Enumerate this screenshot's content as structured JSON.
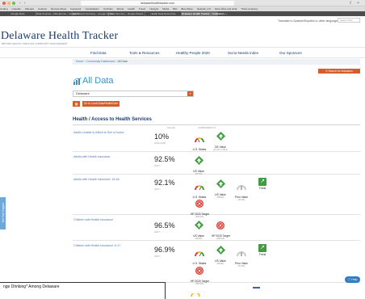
{
  "browser": {
    "url": "delawarehealthtracker.com",
    "bookmarks": [
      "Coding",
      "LinkedIn",
      "Kitboard",
      "Amazon",
      "Remote Sheet",
      "Facebook",
      "Constellation",
      "YouTube",
      "Words",
      "Health",
      "Travel",
      "Lifestyle",
      "Media",
      "BIG",
      "Blue Wave",
      "Network_CS",
      "Store Wow and what",
      "That's Amazing"
    ],
    "tabs": [
      "Google Docs",
      "Data Sources – DE Harmes – Google S...",
      "Dashboard Overview – Google Slides",
      "Data Sources – Google Sheets",
      "Health Data Resources",
      "Delaware Health Tracker :: Indicators :..."
    ],
    "active_tab_index": 5
  },
  "site": {
    "translate_label": "Translate to Spanish/Español or other language",
    "search_placeholder": "Search Site",
    "title": "Delaware Health Tracker",
    "tagline": "BETTER HEALTH THROUGH COMMUNITY ENGAGEMENT"
  },
  "nav": {
    "items": [
      "Find Data",
      "Tools & Resources",
      "Healthy People 2020",
      "Socio-Needs Index",
      "Our Sponsors"
    ]
  },
  "breadcrumb": {
    "home": "Home",
    "dashboard": "Community Dashboard",
    "current": "All Data"
  },
  "search_indicators_label": "Search for Indicators",
  "page_title": "All Data",
  "location_select": {
    "value": "Delaware"
  },
  "local_data_button": "Go to Local Data/HealthCare",
  "section": {
    "title": "Health / Access to Health Services",
    "col_value": "VALUE",
    "col_compared": "COMPARED TO:"
  },
  "rows": [
    {
      "name": "Adults Unable to Afford to See a Doctor",
      "value": "10%",
      "sub": "(2016-2018)",
      "inds": [
        {
          "type": "gauge",
          "label": "U.S. States",
          "sub": ""
        },
        {
          "type": "diamond-up",
          "label": "DE Value",
          "sub": "(11.6% in 2014)"
        }
      ]
    },
    {
      "name": "Adults with Health Insurance",
      "value": "92.5%",
      "sub": "(2017)",
      "inds": [
        {
          "type": "diamond-up",
          "label": "US Value",
          "sub": "(87.7%)"
        }
      ]
    },
    {
      "name": "Adults with Health Insurance: 18-64",
      "value": "92.1%",
      "sub": "(2017)",
      "inds": [
        {
          "type": "gauge",
          "label": "U.S. States",
          "sub": ""
        },
        {
          "type": "diamond-up",
          "label": "US Value",
          "sub": "(88.0%)"
        },
        {
          "type": "gauge",
          "label": "Prior Value",
          "sub": "(91.3%)"
        },
        {
          "type": "trend",
          "label": "Trend",
          "sub": ""
        },
        {
          "type": "circle-x",
          "label": "HP 2020 Target",
          "sub": "(100.0%)"
        }
      ]
    },
    {
      "name": "Children with Health Insurance",
      "value": "96.5%",
      "sub": "(2017)",
      "inds": [
        {
          "type": "diamond-up",
          "label": "US Value",
          "sub": "(95.0%)"
        },
        {
          "type": "circle-x",
          "label": "HP 2020 Target",
          "sub": "(100.0%)"
        }
      ]
    },
    {
      "name": "Children with Health Insurance: 6-17",
      "value": "96.9%",
      "sub": "(2017)",
      "inds": [
        {
          "type": "gauge",
          "label": "U.S. States",
          "sub": ""
        },
        {
          "type": "diamond-up",
          "label": "US Value",
          "sub": "(95.0%)"
        },
        {
          "type": "gauge",
          "label": "Prior Value",
          "sub": "(97.0%)"
        },
        {
          "type": "trend",
          "label": "Trend",
          "sub": ""
        },
        {
          "type": "circle-x",
          "label": "HP 2020 Target",
          "sub": "(100.0%)"
        }
      ]
    }
  ],
  "side_tab_label": "Get Tool Support",
  "overlay_text": "nge Drinking* Among Delaware",
  "help_label": "Help",
  "colors": {
    "navy": "#1d3c6e",
    "link": "#4a78b0",
    "accent_orange": "#d25e2e",
    "green": "#3f9c3f",
    "red": "#d93b30",
    "title_blue": "#3c8fc4"
  }
}
